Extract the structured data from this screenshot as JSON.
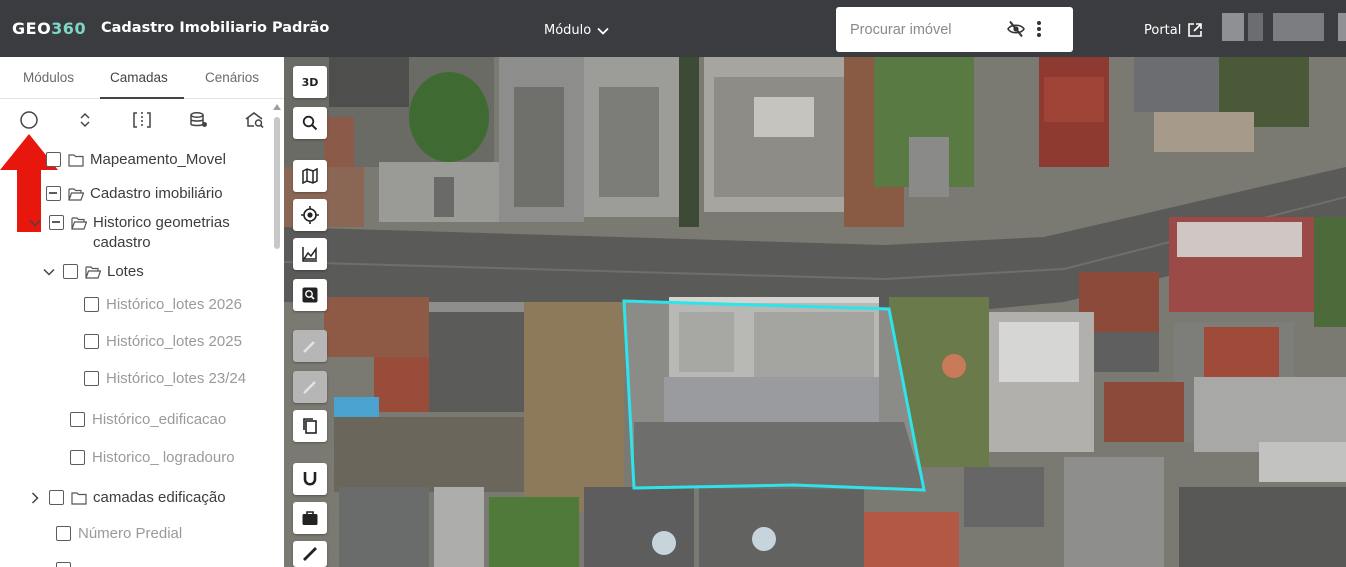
{
  "header": {
    "logo_prefix": "GEO",
    "logo_suffix": "360",
    "app_title": "Cadastro Imobiliario Padrão",
    "module_label": "Módulo",
    "search_placeholder": "Procurar imóvel",
    "portal_label": "Portal"
  },
  "sidebar": {
    "tabs": [
      "Módulos",
      "Camadas",
      "Cenários"
    ],
    "active_tab": "Camadas",
    "tree": [
      {
        "label": "Mapeamento_Movel"
      },
      {
        "label": "Cadastro imobiliário"
      },
      {
        "label_line1": "Historico geometrias",
        "label_line2": "cadastro"
      },
      {
        "label": "Lotes"
      },
      {
        "label": "Histórico_lotes 2026"
      },
      {
        "label": "Histórico_lotes 2025"
      },
      {
        "label": "Histórico_lotes 23/24"
      },
      {
        "label": "Histórico_edificacao"
      },
      {
        "label": "Historico_ logradouro"
      },
      {
        "label": "camadas edificação"
      },
      {
        "label": "Número Predial"
      }
    ]
  },
  "map": {
    "tool_3d_label": "3D",
    "highlight_color": "#2fe3ea"
  }
}
